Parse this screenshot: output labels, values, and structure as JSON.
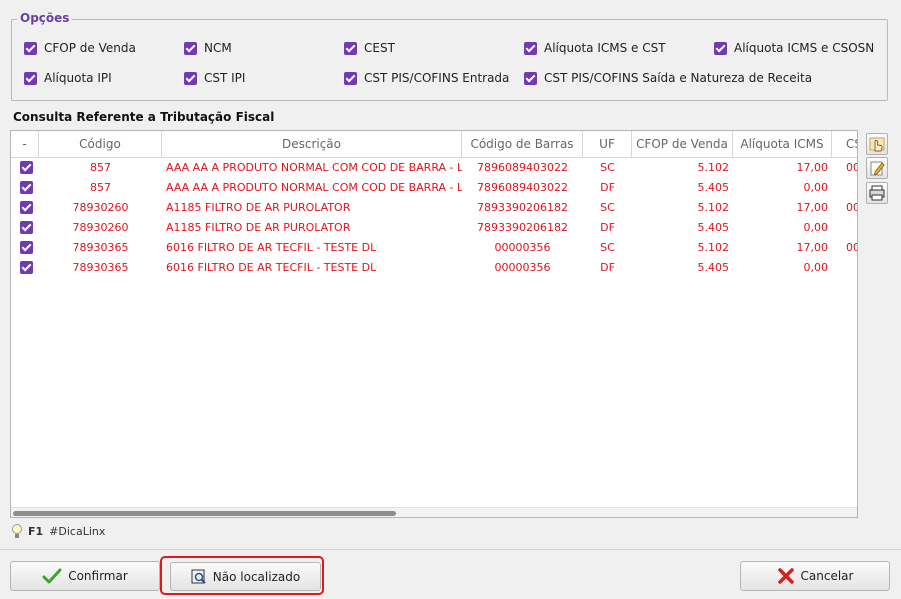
{
  "options": {
    "legend": "Opções",
    "items": [
      {
        "label": "CFOP de Venda",
        "checked": true
      },
      {
        "label": "NCM",
        "checked": true
      },
      {
        "label": "CEST",
        "checked": true
      },
      {
        "label": "Alíquota ICMS e CST",
        "checked": true
      },
      {
        "label": "Alíquota ICMS e CSOSN",
        "checked": true
      },
      {
        "label": "Alíquota IPI",
        "checked": true
      },
      {
        "label": "CST IPI",
        "checked": true
      },
      {
        "label": "CST PIS/COFINS Entrada",
        "checked": true
      },
      {
        "label": "CST PIS/COFINS Saída e Natureza de Receita",
        "checked": true
      }
    ]
  },
  "grid": {
    "title": "Consulta Referente a Tributação Fiscal",
    "columns": [
      "-",
      "Código",
      "Descrição",
      "Código de Barras",
      "UF",
      "CFOP de Venda",
      "Alíquota ICMS",
      "CS"
    ],
    "rows": [
      {
        "checked": true,
        "codigo": "857",
        "descricao": "AAA AA A PRODUTO NORMAL COM COD DE BARRA - L",
        "barras": "7896089403022",
        "uf": "SC",
        "cfop": "5.102",
        "aliquota": "17,00",
        "cs": "00"
      },
      {
        "checked": true,
        "codigo": "857",
        "descricao": "AAA AA A PRODUTO NORMAL COM COD DE BARRA - L",
        "barras": "7896089403022",
        "uf": "DF",
        "cfop": "5.405",
        "aliquota": "0,00",
        "cs": ""
      },
      {
        "checked": true,
        "codigo": "78930260",
        "descricao": "A1185 FILTRO DE AR PUROLATOR",
        "barras": "7893390206182",
        "uf": "SC",
        "cfop": "5.102",
        "aliquota": "17,00",
        "cs": "00"
      },
      {
        "checked": true,
        "codigo": "78930260",
        "descricao": "A1185 FILTRO DE AR PUROLATOR",
        "barras": "7893390206182",
        "uf": "DF",
        "cfop": "5.405",
        "aliquota": "0,00",
        "cs": ""
      },
      {
        "checked": true,
        "codigo": "78930365",
        "descricao": "6016 FILTRO DE AR TECFIL - TESTE DL",
        "barras": "00000356",
        "uf": "SC",
        "cfop": "5.102",
        "aliquota": "17,00",
        "cs": "00"
      },
      {
        "checked": true,
        "codigo": "78930365",
        "descricao": "6016 FILTRO DE AR TECFIL - TESTE DL",
        "barras": "00000356",
        "uf": "DF",
        "cfop": "5.405",
        "aliquota": "0,00",
        "cs": ""
      }
    ],
    "side_tools": [
      "hand-pointer-icon",
      "edit-pencil-icon",
      "print-icon"
    ]
  },
  "tip": {
    "key": "F1",
    "text": "#DicaLinx"
  },
  "buttons": {
    "confirm": "Confirmar",
    "not_found": "Não localizado",
    "cancel": "Cancelar"
  },
  "colors": {
    "accent": "#6f3ab2",
    "row_text": "#e0141e",
    "highlight": "#e01818"
  }
}
